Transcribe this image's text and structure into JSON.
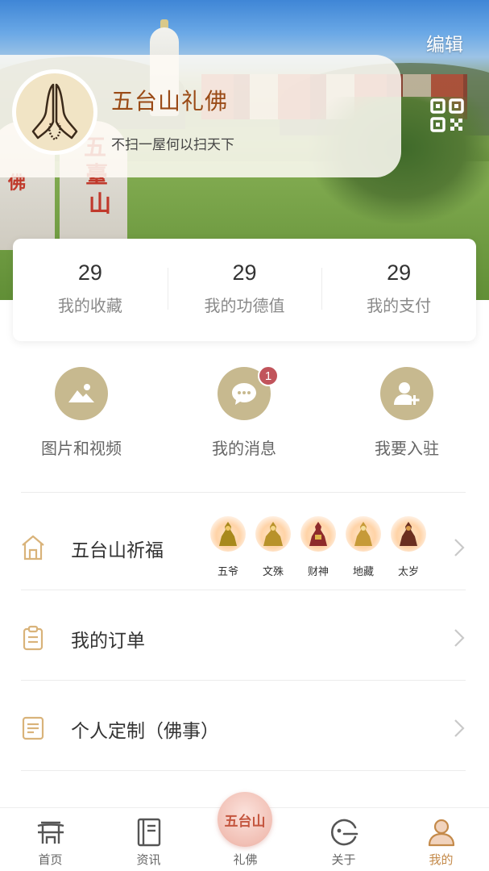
{
  "header": {
    "edit_label": "编辑",
    "banner_stone_text": [
      "五",
      "臺",
      "山"
    ],
    "banner_stone_text_left": "佛"
  },
  "profile": {
    "name": "五台山礼佛",
    "motto": "不扫一屋何以扫天下",
    "avatar_icon": "praying-hands-icon",
    "qr_icon": "qr-code-icon"
  },
  "stats": [
    {
      "value": "29",
      "label": "我的收藏"
    },
    {
      "value": "29",
      "label": "我的功德值"
    },
    {
      "value": "29",
      "label": "我的支付"
    }
  ],
  "quick_actions": [
    {
      "label": "图片和视频",
      "icon": "image-icon"
    },
    {
      "label": "我的消息",
      "icon": "message-icon",
      "badge": "1"
    },
    {
      "label": "我要入驻",
      "icon": "add-user-icon"
    }
  ],
  "menu": [
    {
      "label": "五台山祈福",
      "icon": "temple-icon",
      "deities": [
        "五爷",
        "文殊",
        "财神",
        "地藏",
        "太岁"
      ]
    },
    {
      "label": "我的订单",
      "icon": "clipboard-icon"
    },
    {
      "label": "个人定制（佛事）",
      "icon": "document-icon"
    }
  ],
  "tabbar": {
    "items": [
      {
        "label": "首页",
        "icon": "home-gate-icon"
      },
      {
        "label": "资讯",
        "icon": "book-icon"
      },
      {
        "label": "礼佛",
        "icon": "wutaishan-logo-icon",
        "center_text": "五台山"
      },
      {
        "label": "关于",
        "icon": "about-icon"
      },
      {
        "label": "我的",
        "icon": "user-icon",
        "active": true
      }
    ]
  },
  "colors": {
    "accent_gold": "#c7b98f",
    "name_brown": "#9a4a16",
    "badge_red": "#c1545b",
    "active_tab": "#c48a4a"
  }
}
